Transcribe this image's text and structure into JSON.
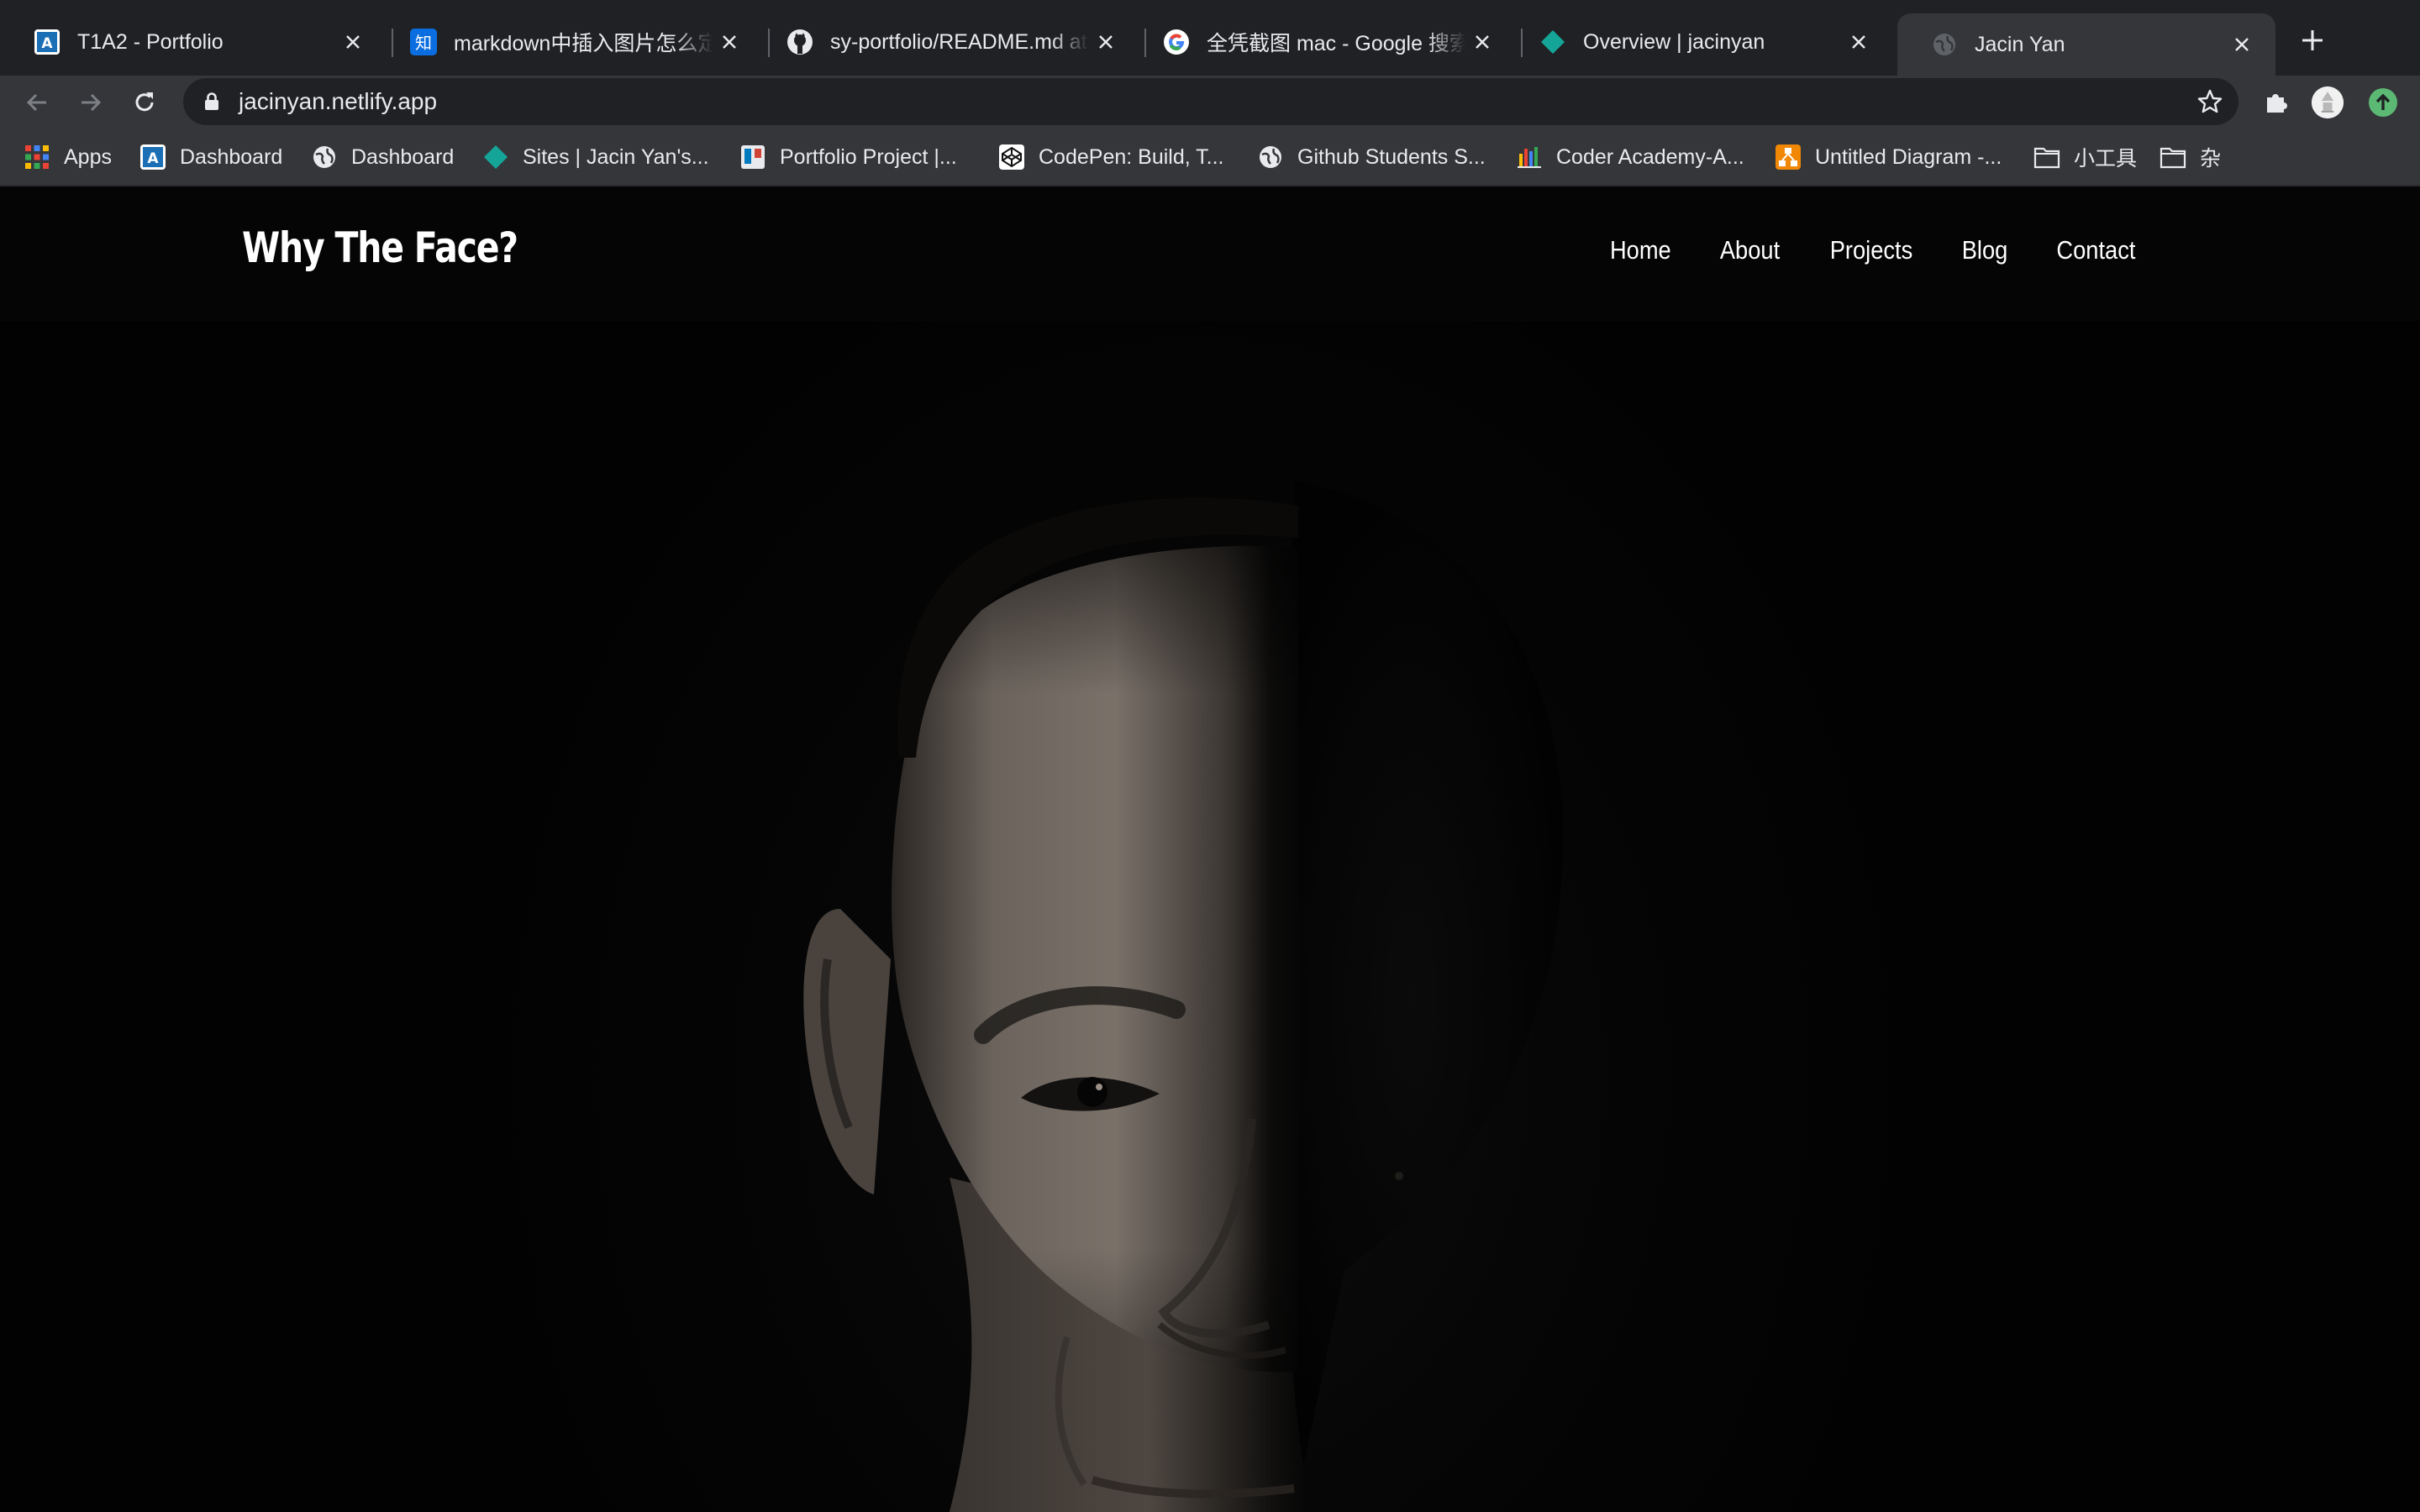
{
  "browser": {
    "tabs": [
      {
        "title": "T1A2 - Portfolio",
        "icon": "coder-academy-icon",
        "active": false
      },
      {
        "title": "markdown中插入图片怎么定义",
        "icon": "zhihu-icon",
        "active": false
      },
      {
        "title": "sy-portfolio/README.md at",
        "icon": "github-icon",
        "active": false
      },
      {
        "title": "全凭截图 mac - Google 搜索",
        "icon": "google-icon",
        "active": false
      },
      {
        "title": "Overview | jacinyan",
        "icon": "netlify-icon",
        "active": false
      },
      {
        "title": "Jacin Yan",
        "icon": "globe-icon",
        "active": true
      }
    ],
    "address": {
      "url": "jacinyan.netlify.app"
    },
    "bookmarks": [
      {
        "label": "Apps",
        "icon": "apps-grid-icon"
      },
      {
        "label": "Dashboard",
        "icon": "coder-academy-icon"
      },
      {
        "label": "Dashboard",
        "icon": "globe-icon"
      },
      {
        "label": "Sites | Jacin Yan's...",
        "icon": "netlify-icon"
      },
      {
        "label": "Portfolio Project |...",
        "icon": "trello-icon"
      },
      {
        "label": "CodePen: Build, T...",
        "icon": "codepen-icon"
      },
      {
        "label": "Github Students S...",
        "icon": "globe-icon"
      },
      {
        "label": "Coder Academy-A...",
        "icon": "chart-icon"
      },
      {
        "label": "Untitled Diagram -...",
        "icon": "drawio-icon"
      },
      {
        "label": "小工具",
        "icon": "folder-icon"
      },
      {
        "label": "杂",
        "icon": "folder-icon"
      }
    ],
    "colors": {
      "tabstrip": "#202124",
      "toolbar": "#35363a",
      "omnibox": "#202124",
      "text": "#e8eaed"
    }
  },
  "site": {
    "brand": "Why The Face?",
    "nav": [
      {
        "label": "Home"
      },
      {
        "label": "About"
      },
      {
        "label": "Projects"
      },
      {
        "label": "Blog"
      },
      {
        "label": "Contact"
      }
    ],
    "hero": {
      "image": "half-lit-face-portrait"
    },
    "colors": {
      "background": "#020202",
      "header": "#050505",
      "text": "#ffffff"
    }
  }
}
